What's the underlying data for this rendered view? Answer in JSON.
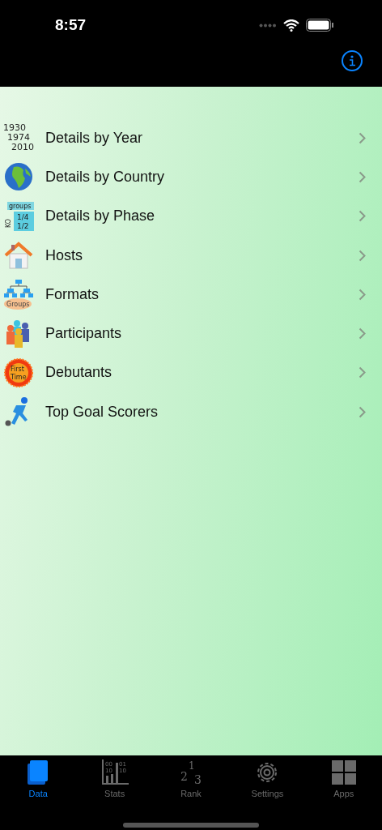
{
  "status_bar": {
    "time": "8:57"
  },
  "menu": [
    {
      "label": "Details by Year",
      "kind": "years",
      "icon_text": [
        "1930",
        "1974",
        "2010"
      ]
    },
    {
      "label": "Details by Country",
      "kind": "globe"
    },
    {
      "label": "Details by Phase",
      "kind": "phases",
      "icon_text": [
        "groups",
        "KO",
        "1/4",
        "1/2"
      ]
    },
    {
      "label": "Hosts",
      "kind": "house"
    },
    {
      "label": "Formats",
      "kind": "bracket",
      "icon_text": [
        "Groups"
      ]
    },
    {
      "label": "Participants",
      "kind": "people"
    },
    {
      "label": "Debutants",
      "kind": "badge",
      "icon_text": [
        "First",
        "Time"
      ]
    },
    {
      "label": "Top Goal Scorers",
      "kind": "runner"
    }
  ],
  "tab_bar": [
    {
      "label": "Data",
      "kind": "book",
      "selected": true
    },
    {
      "label": "Stats",
      "kind": "stats",
      "selected": false,
      "icon_text": [
        "00",
        "01",
        "10",
        "10"
      ]
    },
    {
      "label": "Rank",
      "kind": "rank",
      "selected": false,
      "icon_text": [
        "2",
        "1",
        "3"
      ]
    },
    {
      "label": "Settings",
      "kind": "gear",
      "selected": false
    },
    {
      "label": "Apps",
      "kind": "grid",
      "selected": false
    }
  ]
}
